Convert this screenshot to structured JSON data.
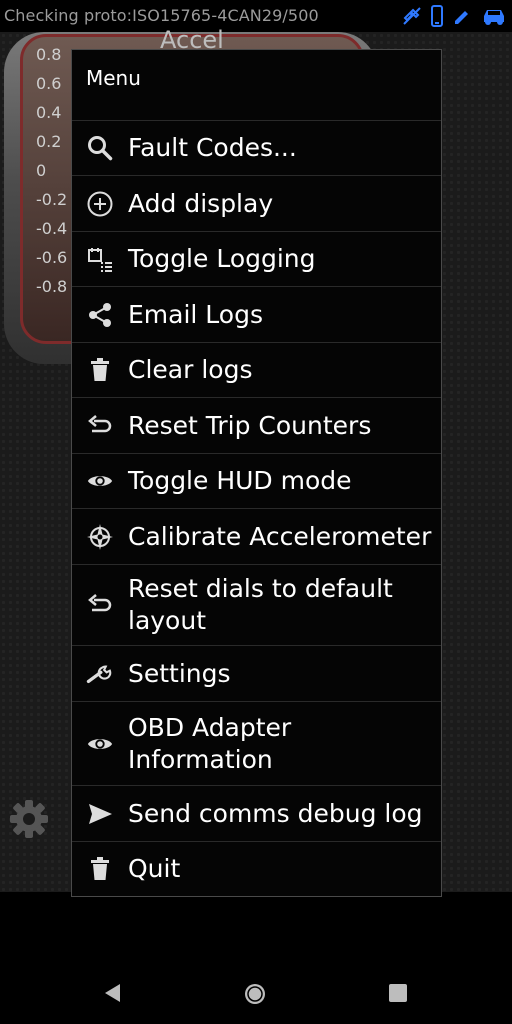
{
  "status_bar": {
    "text": "Checking proto:ISO15765-4CAN29/500",
    "icons": [
      "satellite-off-icon",
      "phone-icon",
      "pen-icon",
      "car-icon"
    ],
    "icon_color": "#2f79ff"
  },
  "gauge": {
    "title": "Accel",
    "scale": [
      "0.8",
      "0.6",
      "0.4",
      "0.2",
      "0",
      "-0.2",
      "-0.4",
      "-0.6",
      "-0.8"
    ]
  },
  "menu": {
    "title": "Menu",
    "items": [
      {
        "label": "Fault Codes...",
        "icon": "search-icon"
      },
      {
        "label": "Add display",
        "icon": "add-circle-icon"
      },
      {
        "label": "Toggle Logging",
        "icon": "log-list-icon"
      },
      {
        "label": "Email Logs",
        "icon": "share-icon"
      },
      {
        "label": "Clear logs",
        "icon": "trash-icon"
      },
      {
        "label": "Reset Trip Counters",
        "icon": "undo-icon"
      },
      {
        "label": "Toggle HUD mode",
        "icon": "eye-icon"
      },
      {
        "label": "Calibrate Accelerometer",
        "icon": "compass-icon"
      },
      {
        "label": "Reset dials to default layout",
        "icon": "undo-icon"
      },
      {
        "label": "Settings",
        "icon": "wrench-icon"
      },
      {
        "label": "OBD Adapter Information",
        "icon": "eye-icon"
      },
      {
        "label": "Send comms debug log",
        "icon": "send-icon"
      },
      {
        "label": "Quit",
        "icon": "trash-icon"
      }
    ]
  },
  "nav_bar": {
    "buttons": [
      "back-icon",
      "home-icon",
      "recents-icon"
    ]
  }
}
